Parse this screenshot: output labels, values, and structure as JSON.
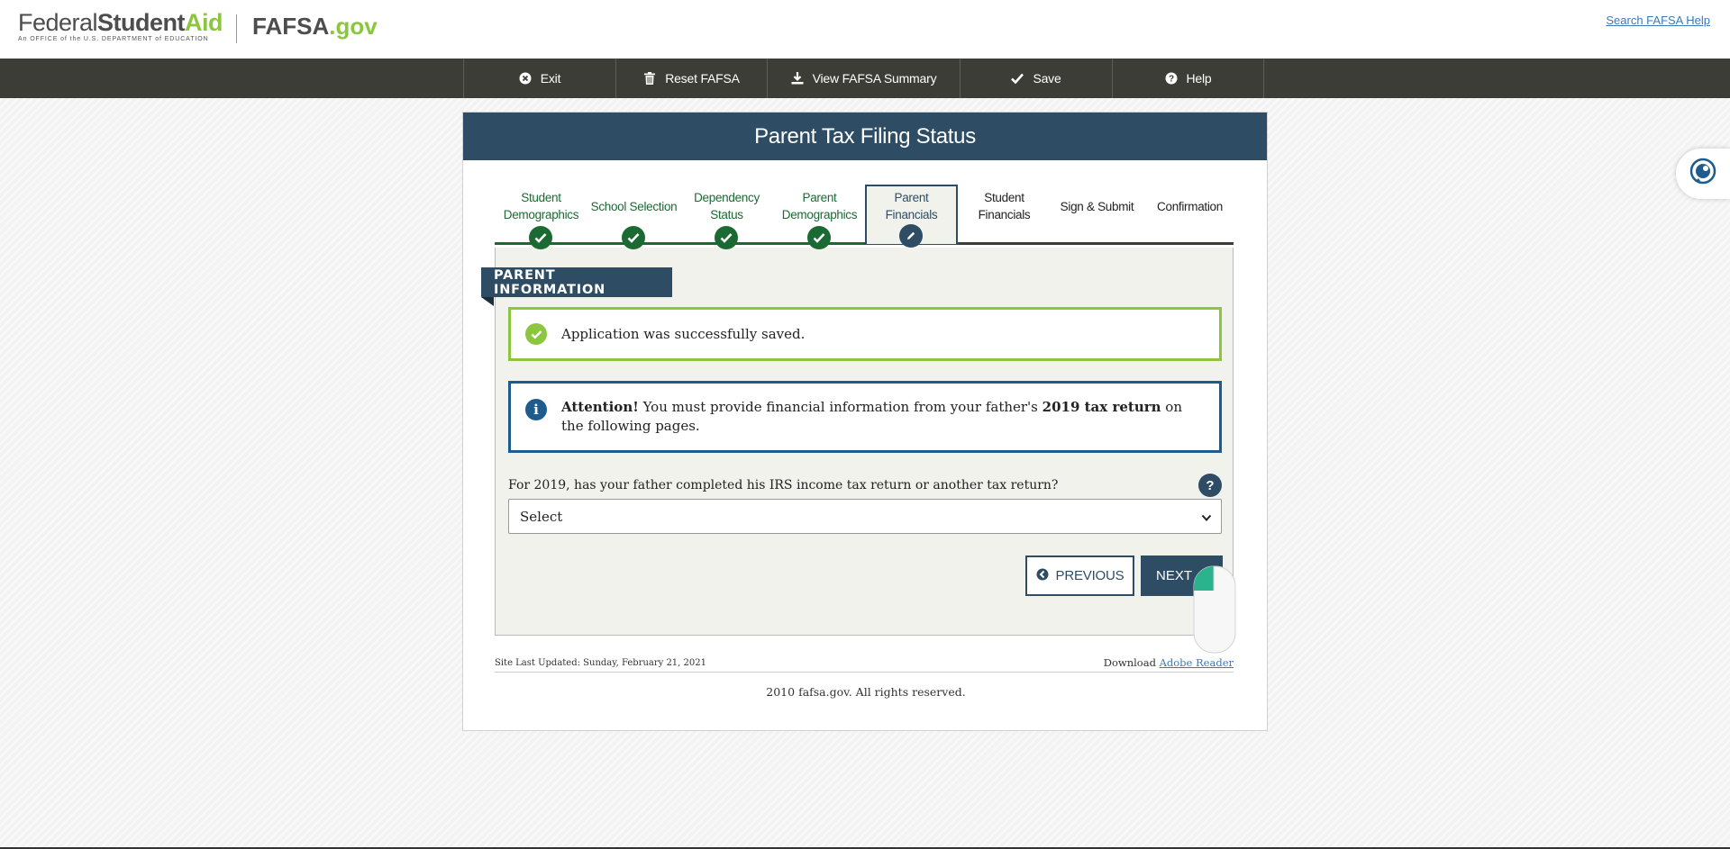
{
  "header": {
    "logo_fed": "Federal",
    "logo_student": "Student",
    "logo_aid": "Aid",
    "logo_subtitle": "An OFFICE of the U.S. DEPARTMENT of EDUCATION",
    "logo_fafsa": "FAFSA",
    "logo_gov": ".gov",
    "search_help": "Search FAFSA Help"
  },
  "nav": {
    "items": [
      {
        "label": "Exit",
        "icon": "close-circle-icon"
      },
      {
        "label": "Reset FAFSA",
        "icon": "trash-icon"
      },
      {
        "label": "View FAFSA Summary",
        "icon": "download-icon"
      },
      {
        "label": "Save",
        "icon": "checkmark-icon"
      },
      {
        "label": "Help",
        "icon": "question-circle-icon"
      }
    ]
  },
  "page": {
    "title": "Parent Tax Filing Status"
  },
  "steps": [
    {
      "label": "Student Demographics",
      "status": "done"
    },
    {
      "label": "School Selection",
      "status": "done"
    },
    {
      "label": "Dependency Status",
      "status": "done"
    },
    {
      "label": "Parent Demographics",
      "status": "done"
    },
    {
      "label": "Parent Financials",
      "status": "active"
    },
    {
      "label": "Student Financials",
      "status": "todo"
    },
    {
      "label": "Sign & Submit",
      "status": "todo"
    },
    {
      "label": "Confirmation",
      "status": "todo"
    }
  ],
  "section": {
    "tag": "PARENT INFORMATION"
  },
  "messages": {
    "success": "Application was successfully saved.",
    "attention_label": "Attention!",
    "attention_pre": " You must provide financial information from your father's ",
    "attention_bold": "2019 tax return",
    "attention_post": " on the following pages."
  },
  "question": {
    "text": "For 2019, has your father completed his IRS income tax return or another tax return?",
    "help": "?",
    "select_value": "Select"
  },
  "buttons": {
    "previous": "PREVIOUS",
    "next": "NEXT"
  },
  "footer": {
    "updated": "Site Last Updated: Sunday, February 21, 2021",
    "download_label": "Download ",
    "download_link": "Adobe Reader",
    "copyright": "2010 fafsa.gov. All rights reserved."
  },
  "colors": {
    "brand_green": "#8cc63f",
    "navy": "#2e4d65",
    "done_green": "#1b6a33",
    "nav_bg": "#3d3d37"
  }
}
